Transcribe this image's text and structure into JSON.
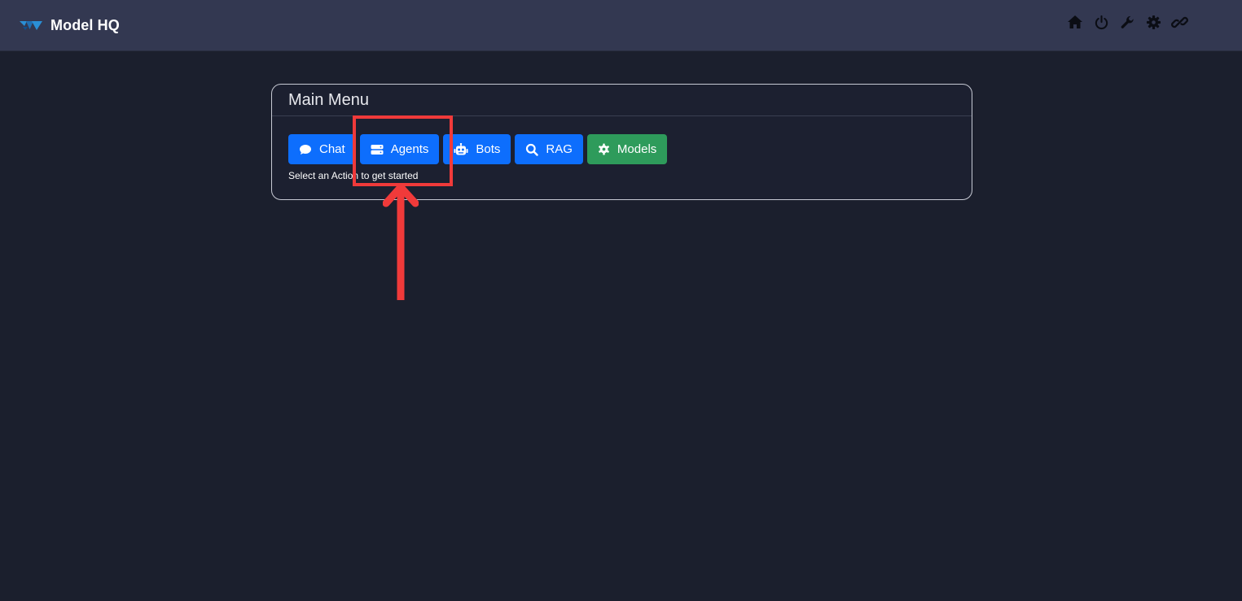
{
  "app": {
    "name": "Model HQ"
  },
  "header_icons": [
    "home-icon",
    "power-icon",
    "wrench-icon",
    "gear-icon",
    "link-icon"
  ],
  "panel": {
    "title": "Main Menu",
    "hint": "Select an Action to get started"
  },
  "buttons": {
    "chat": "Chat",
    "agents": "Agents",
    "bots": "Bots",
    "rag": "RAG",
    "models": "Models"
  },
  "colors": {
    "background": "#1b1f2d",
    "topbar": "#333851",
    "primary": "#0d6efd",
    "success": "#2e9b5b",
    "annotation": "#f03a3a"
  }
}
